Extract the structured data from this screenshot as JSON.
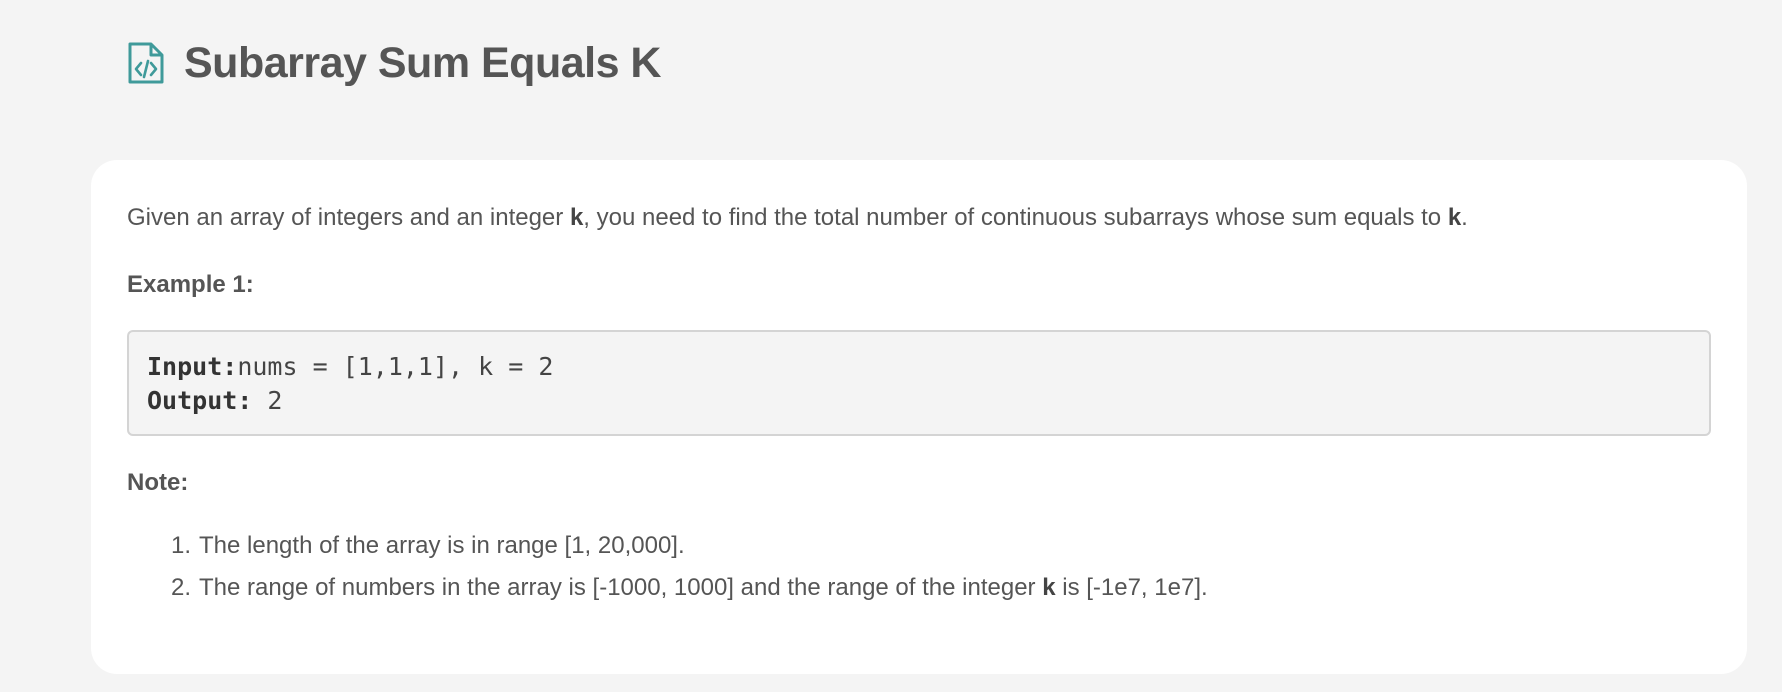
{
  "header": {
    "title": "Subarray Sum Equals K",
    "icon": "code-file-icon",
    "icon_color": "#3f9a9a"
  },
  "intro": {
    "part1": "Given an array of integers and an integer ",
    "k1": "k",
    "part2": ", you need to find the total number of continuous subarrays whose sum equals to ",
    "k2": "k",
    "part3": "."
  },
  "example": {
    "heading": "Example 1:",
    "input_label": "Input:",
    "input_value": "nums = [1,1,1], k = 2",
    "output_label": "Output:",
    "output_value": " 2"
  },
  "note": {
    "heading": "Note:",
    "items": [
      {
        "num": "1.",
        "text": "The length of the array is in range [1, 20,000]."
      },
      {
        "num": "2.",
        "part1": "The range of numbers in the array is [-1000, 1000] and the range of the integer ",
        "k": "k",
        "part2": " is [-1e7, 1e7]."
      }
    ]
  }
}
